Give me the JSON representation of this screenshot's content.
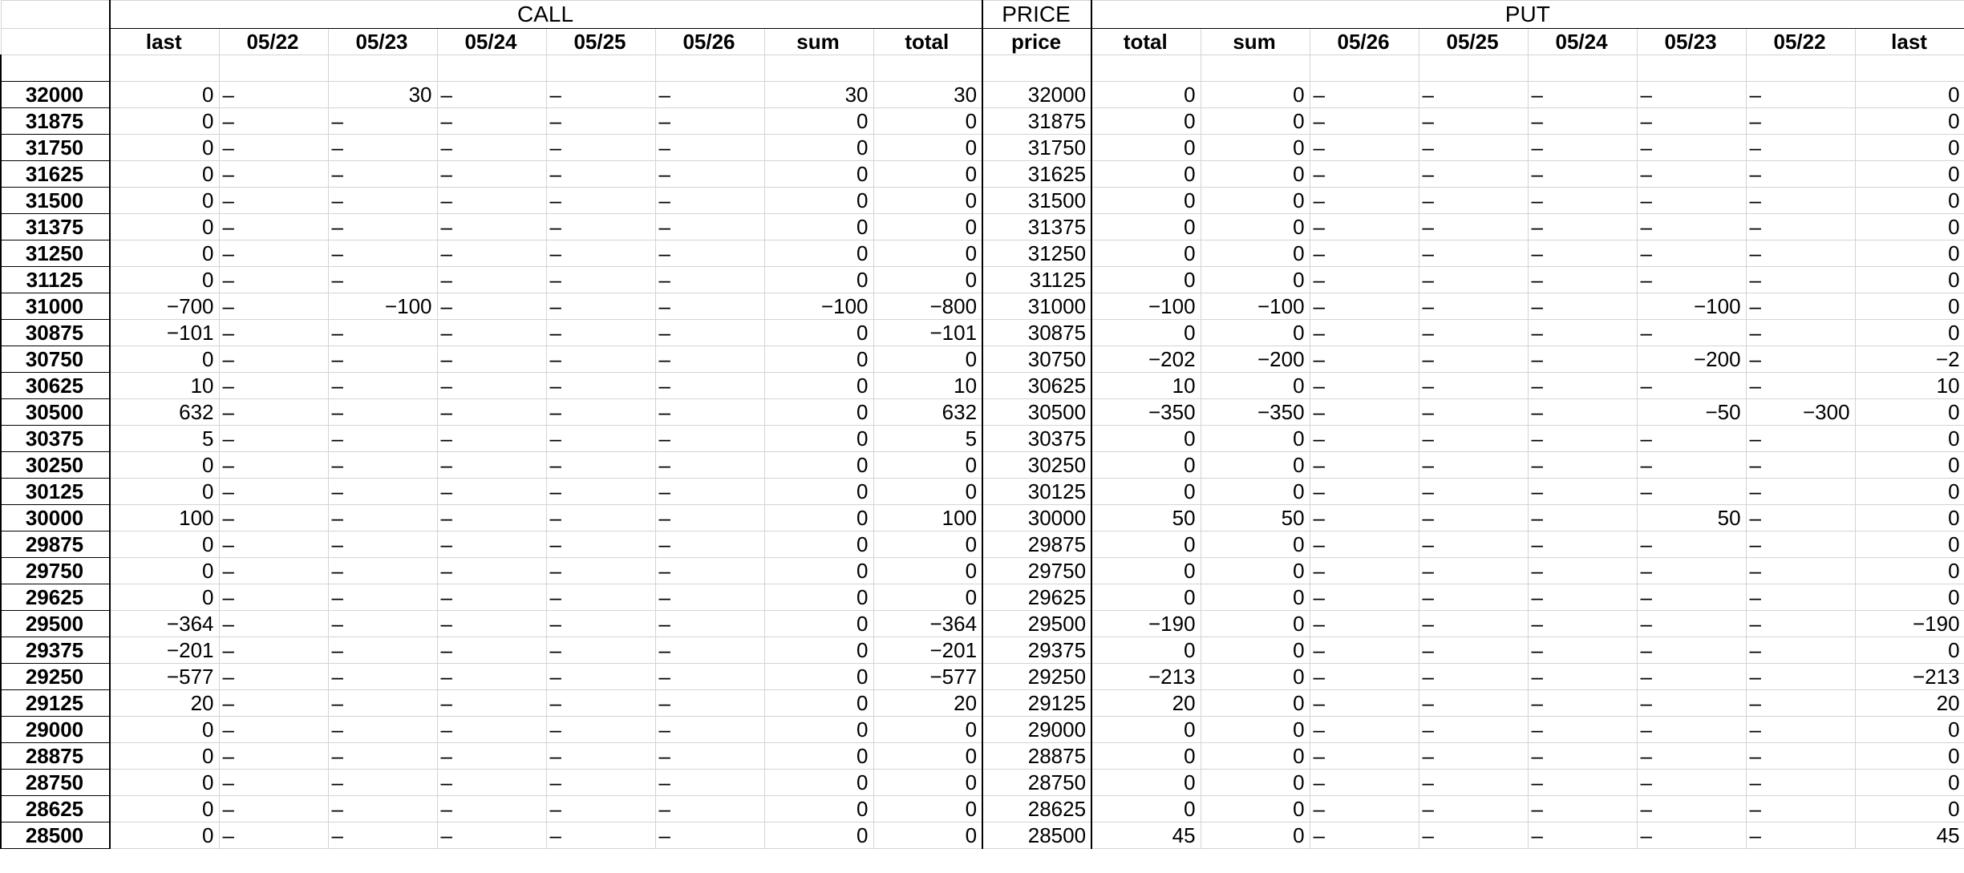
{
  "groups": {
    "call": "CALL",
    "price": "PRICE",
    "put": "PUT"
  },
  "call_headers": [
    "last",
    "05/22",
    "05/23",
    "05/24",
    "05/25",
    "05/26",
    "sum",
    "total"
  ],
  "price_header": "price",
  "put_headers": [
    "total",
    "sum",
    "05/26",
    "05/25",
    "05/24",
    "05/23",
    "05/22",
    "last"
  ],
  "rows": [
    {
      "strike": "32000",
      "call": [
        "0",
        "–",
        "30",
        "–",
        "–",
        "–",
        "30",
        "30"
      ],
      "price": "32000",
      "put": [
        "0",
        "0",
        "–",
        "–",
        "–",
        "–",
        "–",
        "0"
      ]
    },
    {
      "strike": "31875",
      "call": [
        "0",
        "–",
        "–",
        "–",
        "–",
        "–",
        "0",
        "0"
      ],
      "price": "31875",
      "put": [
        "0",
        "0",
        "–",
        "–",
        "–",
        "–",
        "–",
        "0"
      ]
    },
    {
      "strike": "31750",
      "call": [
        "0",
        "–",
        "–",
        "–",
        "–",
        "–",
        "0",
        "0"
      ],
      "price": "31750",
      "put": [
        "0",
        "0",
        "–",
        "–",
        "–",
        "–",
        "–",
        "0"
      ]
    },
    {
      "strike": "31625",
      "call": [
        "0",
        "–",
        "–",
        "–",
        "–",
        "–",
        "0",
        "0"
      ],
      "price": "31625",
      "put": [
        "0",
        "0",
        "–",
        "–",
        "–",
        "–",
        "–",
        "0"
      ]
    },
    {
      "strike": "31500",
      "call": [
        "0",
        "–",
        "–",
        "–",
        "–",
        "–",
        "0",
        "0"
      ],
      "price": "31500",
      "put": [
        "0",
        "0",
        "–",
        "–",
        "–",
        "–",
        "–",
        "0"
      ]
    },
    {
      "strike": "31375",
      "call": [
        "0",
        "–",
        "–",
        "–",
        "–",
        "–",
        "0",
        "0"
      ],
      "price": "31375",
      "put": [
        "0",
        "0",
        "–",
        "–",
        "–",
        "–",
        "–",
        "0"
      ]
    },
    {
      "strike": "31250",
      "call": [
        "0",
        "–",
        "–",
        "–",
        "–",
        "–",
        "0",
        "0"
      ],
      "price": "31250",
      "put": [
        "0",
        "0",
        "–",
        "–",
        "–",
        "–",
        "–",
        "0"
      ]
    },
    {
      "strike": "31125",
      "call": [
        "0",
        "–",
        "–",
        "–",
        "–",
        "–",
        "0",
        "0"
      ],
      "price": "31125",
      "put": [
        "0",
        "0",
        "–",
        "–",
        "–",
        "–",
        "–",
        "0"
      ]
    },
    {
      "strike": "31000",
      "call": [
        "−700",
        "–",
        "−100",
        "–",
        "–",
        "–",
        "−100",
        "−800"
      ],
      "price": "31000",
      "put": [
        "−100",
        "−100",
        "–",
        "–",
        "–",
        "−100",
        "–",
        "0"
      ]
    },
    {
      "strike": "30875",
      "call": [
        "−101",
        "–",
        "–",
        "–",
        "–",
        "–",
        "0",
        "−101"
      ],
      "price": "30875",
      "put": [
        "0",
        "0",
        "–",
        "–",
        "–",
        "–",
        "–",
        "0"
      ]
    },
    {
      "strike": "30750",
      "call": [
        "0",
        "–",
        "–",
        "–",
        "–",
        "–",
        "0",
        "0"
      ],
      "price": "30750",
      "put": [
        "−202",
        "−200",
        "–",
        "–",
        "–",
        "−200",
        "–",
        "−2"
      ]
    },
    {
      "strike": "30625",
      "call": [
        "10",
        "–",
        "–",
        "–",
        "–",
        "–",
        "0",
        "10"
      ],
      "price": "30625",
      "put": [
        "10",
        "0",
        "–",
        "–",
        "–",
        "–",
        "–",
        "10"
      ]
    },
    {
      "strike": "30500",
      "call": [
        "632",
        "–",
        "–",
        "–",
        "–",
        "–",
        "0",
        "632"
      ],
      "price": "30500",
      "put": [
        "−350",
        "−350",
        "–",
        "–",
        "–",
        "−50",
        "−300",
        "0"
      ]
    },
    {
      "strike": "30375",
      "call": [
        "5",
        "–",
        "–",
        "–",
        "–",
        "–",
        "0",
        "5"
      ],
      "price": "30375",
      "put": [
        "0",
        "0",
        "–",
        "–",
        "–",
        "–",
        "–",
        "0"
      ]
    },
    {
      "strike": "30250",
      "call": [
        "0",
        "–",
        "–",
        "–",
        "–",
        "–",
        "0",
        "0"
      ],
      "price": "30250",
      "put": [
        "0",
        "0",
        "–",
        "–",
        "–",
        "–",
        "–",
        "0"
      ]
    },
    {
      "strike": "30125",
      "call": [
        "0",
        "–",
        "–",
        "–",
        "–",
        "–",
        "0",
        "0"
      ],
      "price": "30125",
      "put": [
        "0",
        "0",
        "–",
        "–",
        "–",
        "–",
        "–",
        "0"
      ]
    },
    {
      "strike": "30000",
      "call": [
        "100",
        "–",
        "–",
        "–",
        "–",
        "–",
        "0",
        "100"
      ],
      "price": "30000",
      "put": [
        "50",
        "50",
        "–",
        "–",
        "–",
        "50",
        "–",
        "0"
      ]
    },
    {
      "strike": "29875",
      "call": [
        "0",
        "–",
        "–",
        "–",
        "–",
        "–",
        "0",
        "0"
      ],
      "price": "29875",
      "put": [
        "0",
        "0",
        "–",
        "–",
        "–",
        "–",
        "–",
        "0"
      ]
    },
    {
      "strike": "29750",
      "call": [
        "0",
        "–",
        "–",
        "–",
        "–",
        "–",
        "0",
        "0"
      ],
      "price": "29750",
      "put": [
        "0",
        "0",
        "–",
        "–",
        "–",
        "–",
        "–",
        "0"
      ]
    },
    {
      "strike": "29625",
      "call": [
        "0",
        "–",
        "–",
        "–",
        "–",
        "–",
        "0",
        "0"
      ],
      "price": "29625",
      "put": [
        "0",
        "0",
        "–",
        "–",
        "–",
        "–",
        "–",
        "0"
      ]
    },
    {
      "strike": "29500",
      "call": [
        "−364",
        "–",
        "–",
        "–",
        "–",
        "–",
        "0",
        "−364"
      ],
      "price": "29500",
      "put": [
        "−190",
        "0",
        "–",
        "–",
        "–",
        "–",
        "–",
        "−190"
      ]
    },
    {
      "strike": "29375",
      "call": [
        "−201",
        "–",
        "–",
        "–",
        "–",
        "–",
        "0",
        "−201"
      ],
      "price": "29375",
      "put": [
        "0",
        "0",
        "–",
        "–",
        "–",
        "–",
        "–",
        "0"
      ]
    },
    {
      "strike": "29250",
      "call": [
        "−577",
        "–",
        "–",
        "–",
        "–",
        "–",
        "0",
        "−577"
      ],
      "price": "29250",
      "put": [
        "−213",
        "0",
        "–",
        "–",
        "–",
        "–",
        "–",
        "−213"
      ]
    },
    {
      "strike": "29125",
      "call": [
        "20",
        "–",
        "–",
        "–",
        "–",
        "–",
        "0",
        "20"
      ],
      "price": "29125",
      "put": [
        "20",
        "0",
        "–",
        "–",
        "–",
        "–",
        "–",
        "20"
      ]
    },
    {
      "strike": "29000",
      "call": [
        "0",
        "–",
        "–",
        "–",
        "–",
        "–",
        "0",
        "0"
      ],
      "price": "29000",
      "put": [
        "0",
        "0",
        "–",
        "–",
        "–",
        "–",
        "–",
        "0"
      ]
    },
    {
      "strike": "28875",
      "call": [
        "0",
        "–",
        "–",
        "–",
        "–",
        "–",
        "0",
        "0"
      ],
      "price": "28875",
      "put": [
        "0",
        "0",
        "–",
        "–",
        "–",
        "–",
        "–",
        "0"
      ]
    },
    {
      "strike": "28750",
      "call": [
        "0",
        "–",
        "–",
        "–",
        "–",
        "–",
        "0",
        "0"
      ],
      "price": "28750",
      "put": [
        "0",
        "0",
        "–",
        "–",
        "–",
        "–",
        "–",
        "0"
      ]
    },
    {
      "strike": "28625",
      "call": [
        "0",
        "–",
        "–",
        "–",
        "–",
        "–",
        "0",
        "0"
      ],
      "price": "28625",
      "put": [
        "0",
        "0",
        "–",
        "–",
        "–",
        "–",
        "–",
        "0"
      ]
    },
    {
      "strike": "28500",
      "call": [
        "0",
        "–",
        "–",
        "–",
        "–",
        "–",
        "0",
        "0"
      ],
      "price": "28500",
      "put": [
        "45",
        "0",
        "–",
        "–",
        "–",
        "–",
        "–",
        "45"
      ]
    }
  ]
}
